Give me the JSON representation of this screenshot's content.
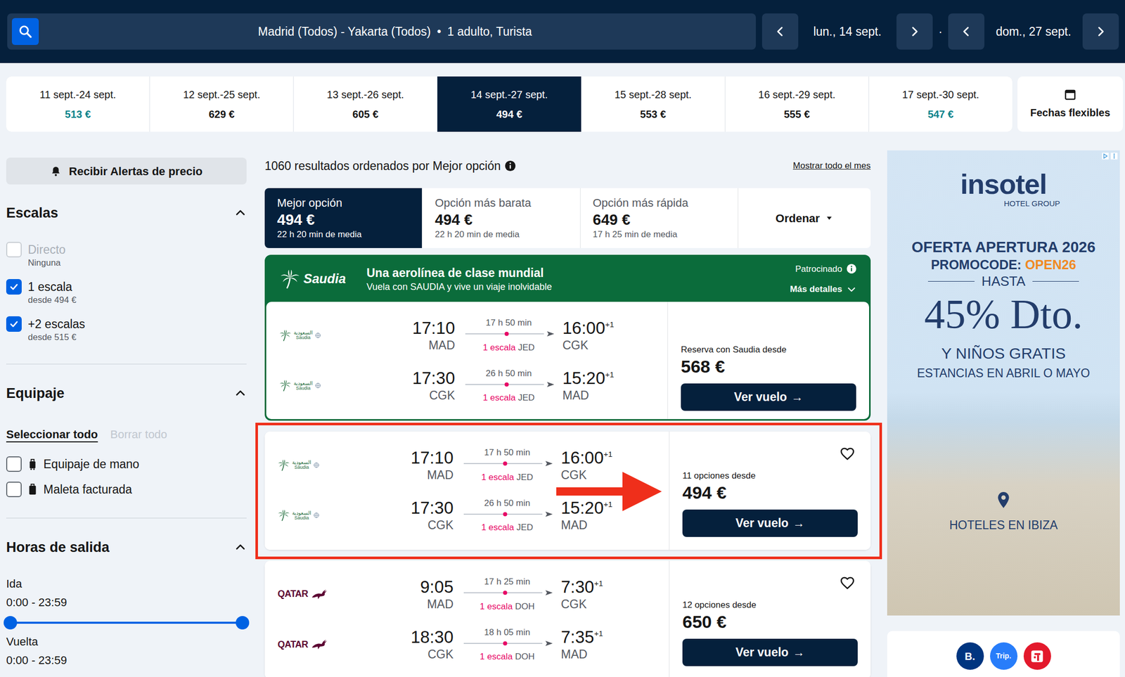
{
  "top_bar": {
    "route": "Madrid (Todos) - Yakarta (Todos)",
    "separator": "•",
    "passengers": "1 adulto, Turista",
    "departure": "lun., 14 sept.",
    "dot": "·",
    "return": "dom., 27 sept."
  },
  "date_strip": {
    "options": [
      {
        "dates": "11 sept.-24 sept.",
        "price": "513 €",
        "selected": false,
        "color": "#0c838a"
      },
      {
        "dates": "12 sept.-25 sept.",
        "price": "629 €",
        "selected": false,
        "color": "#161616"
      },
      {
        "dates": "13 sept.-26 sept.",
        "price": "605 €",
        "selected": false,
        "color": "#161616"
      },
      {
        "dates": "14 sept.-27 sept.",
        "price": "494 €",
        "selected": true,
        "color": "#ffffff"
      },
      {
        "dates": "15 sept.-28 sept.",
        "price": "553 €",
        "selected": false,
        "color": "#161616"
      },
      {
        "dates": "16 sept.-29 sept.",
        "price": "555 €",
        "selected": false,
        "color": "#161616"
      },
      {
        "dates": "17 sept.-30 sept.",
        "price": "547 €",
        "selected": false,
        "color": "#0c838a"
      }
    ],
    "flexible": "Fechas flexibles"
  },
  "sidebar": {
    "alert_button": "Recibir Alertas de precio",
    "stops": {
      "title": "Escalas",
      "expanded": true,
      "options": [
        {
          "label": "Directo",
          "note": "Ninguna",
          "checked": false,
          "disabled": true
        },
        {
          "label": "1 escala",
          "note": "desde 494 €",
          "checked": true,
          "disabled": false
        },
        {
          "label": "+2 escalas",
          "note": "desde 515 €",
          "checked": true,
          "disabled": false
        }
      ]
    },
    "baggage": {
      "title": "Equipaje",
      "expanded": true,
      "select_all": {
        "label": "Seleccionar todo",
        "selected": true
      },
      "clear_all": {
        "label": "Borrar todo",
        "disabled": true
      },
      "options": [
        {
          "label": "Equipaje de mano",
          "checked": false,
          "kind": "hand"
        },
        {
          "label": "Maleta facturada",
          "checked": false,
          "kind": "checked"
        }
      ]
    },
    "departure_times": {
      "title": "Horas de salida",
      "expanded": true,
      "ranges": [
        {
          "label": "Ida",
          "reading": "0:00 - 23:59",
          "low": 0,
          "level": 1
        },
        {
          "label": "Vuelta",
          "reading": "0:00 - 23:59"
        }
      ]
    }
  },
  "results": {
    "summary": "1060 resultados ordenados por Mejor opción",
    "show_month": "Mostrar todo el mes",
    "sort_tabs": [
      {
        "label": "Mejor opción",
        "price": "494 €",
        "sub": "22 h 20 min de media",
        "selected": true
      },
      {
        "label": "Opción más barata",
        "price": "494 €",
        "sub": "22 h 20 min de media",
        "selected": false
      },
      {
        "label": "Opción más rápida",
        "price": "649 €",
        "sub": "17 h 25 min de media",
        "selected": false
      }
    ],
    "sort_menu": "Ordenar"
  },
  "sponsored": {
    "brand": "Saudia",
    "headline": "Una aerolínea de clase mundial",
    "subline": "Vuela con SAUDIA y vive un viaje inolvidable",
    "badge": "Patrocinado",
    "details": "Más detalles",
    "expanded": false,
    "flight": {
      "kind": "saudia",
      "logo_text": "Saudia",
      "logo_arabic": "السعودية",
      "legs": [
        {
          "dep_time": "17:10",
          "dep_airport": "MAD",
          "duration": "17 h 50 min",
          "stops": "1 escala",
          "via": "JED",
          "arr_time": "16:00",
          "arr_plus": "+1",
          "arr_airport": "CGK"
        },
        {
          "dep_time": "17:30",
          "dep_airport": "CGK",
          "duration": "26 h 50 min",
          "stops": "1 escala",
          "via": "JED",
          "arr_time": "15:20",
          "arr_plus": "+1",
          "arr_airport": "MAD"
        }
      ],
      "price_label": "Reserva con Saudia desde",
      "price": "568 €",
      "button": "Ver vuelo",
      "button_icon": "→"
    }
  },
  "flights": [
    {
      "kind": "saudia",
      "logo_text": "Saudia",
      "logo_arabic": "السعودية",
      "highlighted": true,
      "favorite": false,
      "legs": [
        {
          "dep_time": "17:10",
          "dep_airport": "MAD",
          "duration": "17 h 50 min",
          "stops": "1 escala",
          "via": "JED",
          "arr_time": "16:00",
          "arr_plus": "+1",
          "arr_airport": "CGK"
        },
        {
          "dep_time": "17:30",
          "dep_airport": "CGK",
          "duration": "26 h 50 min",
          "stops": "1 escala",
          "via": "JED",
          "arr_time": "15:20",
          "arr_plus": "+1",
          "arr_airport": "MAD"
        }
      ],
      "price_label": "11 opciones desde",
      "price": "494 €",
      "button": "Ver vuelo",
      "button_icon": "→"
    },
    {
      "kind": "qatar",
      "logo_text": "QATAR",
      "highlighted": false,
      "favorite": false,
      "legs": [
        {
          "dep_time": "9:05",
          "dep_airport": "MAD",
          "duration": "17 h 25 min",
          "stops": "1 escala",
          "via": "DOH",
          "arr_time": "7:30",
          "arr_plus": "+1",
          "arr_airport": "CGK"
        },
        {
          "dep_time": "18:30",
          "dep_airport": "CGK",
          "duration": "18 h 05 min",
          "stops": "1 escala",
          "via": "DOH",
          "arr_time": "7:35",
          "arr_plus": "+1",
          "arr_airport": "MAD"
        }
      ],
      "price_label": "12 opciones desde",
      "price": "650 €",
      "button": "Ver vuelo",
      "button_icon": "→"
    }
  ],
  "ad": {
    "brand": "insotel",
    "brand_sub": "HOTEL GROUP",
    "title": "OFERTA APERTURA 2026",
    "promo_label": "PROMOCODE:",
    "promo_code": "OPEN26",
    "upto": "HASTA",
    "discount": "45% Dto.",
    "line1": "Y NIÑOS GRATIS",
    "line2": "ESTANCIAS EN ABRIL O MAYO",
    "cta": "HOTELES EN IBIZA"
  },
  "partners": [
    {
      "label": "B.",
      "color": "#003580",
      "kind": "text"
    },
    {
      "label": "Trip.",
      "color": "#287dfa",
      "kind": "text"
    },
    {
      "label": "",
      "color": "#e3192c",
      "kind": "icon"
    }
  ]
}
